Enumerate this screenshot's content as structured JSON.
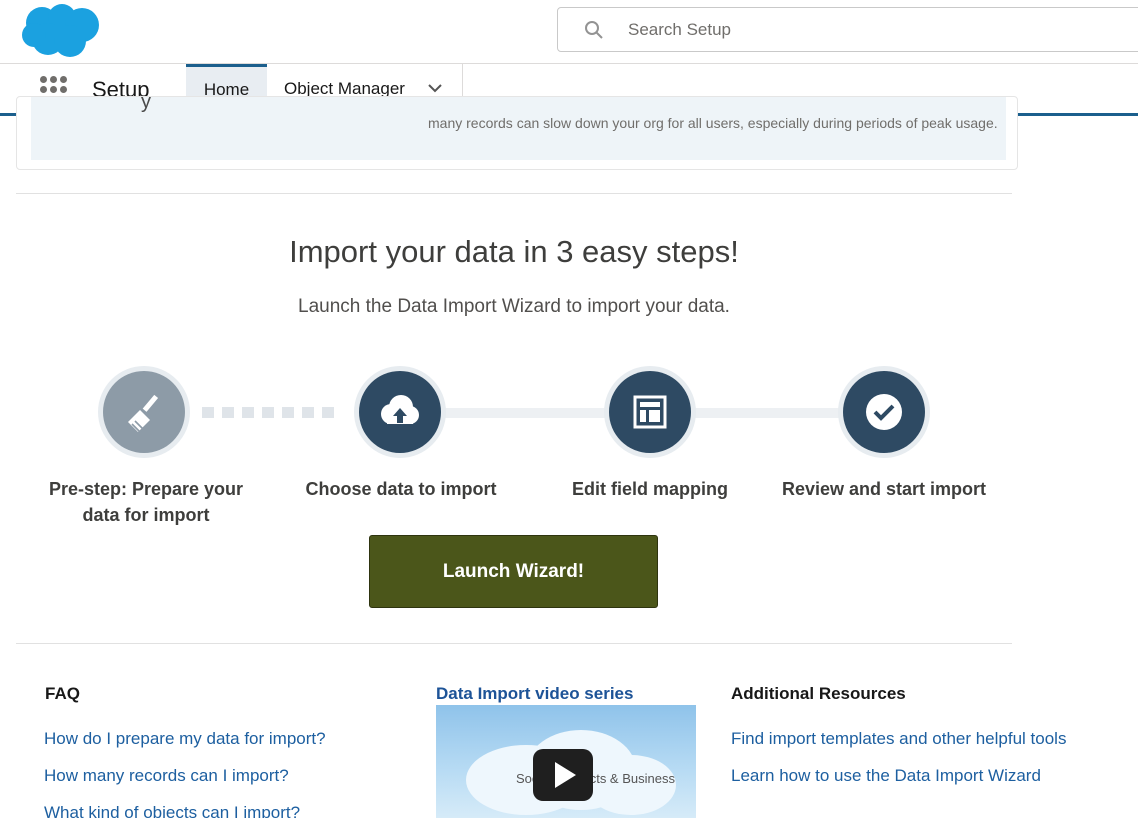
{
  "header": {
    "search_placeholder": "Search Setup"
  },
  "nav": {
    "app_name": "Setup",
    "tabs": [
      {
        "label": "Home",
        "active": true
      },
      {
        "label": "Object Manager",
        "active": false
      }
    ]
  },
  "notice": {
    "text": "many records can slow down your org for all users, especially during periods of peak usage.",
    "clipped_heading": "y"
  },
  "hero": {
    "title": "Import your data in 3 easy steps!",
    "subtitle": "Launch the Data Import Wizard to import your data."
  },
  "steps": [
    {
      "label": "Pre-step: Prepare your data for import",
      "icon": "broom-icon"
    },
    {
      "label": "Choose data to import",
      "icon": "cloud-upload-icon"
    },
    {
      "label": "Edit field mapping",
      "icon": "layout-icon"
    },
    {
      "label": "Review and start import",
      "icon": "check-circle-icon"
    }
  ],
  "launch_button": "Launch Wizard!",
  "faq": {
    "title": "FAQ",
    "links": [
      "How do I prepare my data for import?",
      "How many records can I import?",
      "What kind of objects can I import?"
    ]
  },
  "video": {
    "title": "Data Import video series",
    "thumb_text": "Social Contacts & Business"
  },
  "resources": {
    "title": "Additional Resources",
    "links": [
      "Find import templates and other helpful tools",
      "Learn how to use the Data Import Wizard"
    ]
  },
  "colors": {
    "brand_blue": "#1b5f8d",
    "step_dark": "#2e4a63",
    "step_pre": "#8d9ba7",
    "launch_green": "#4b561a",
    "link": "#1d5fa0"
  }
}
